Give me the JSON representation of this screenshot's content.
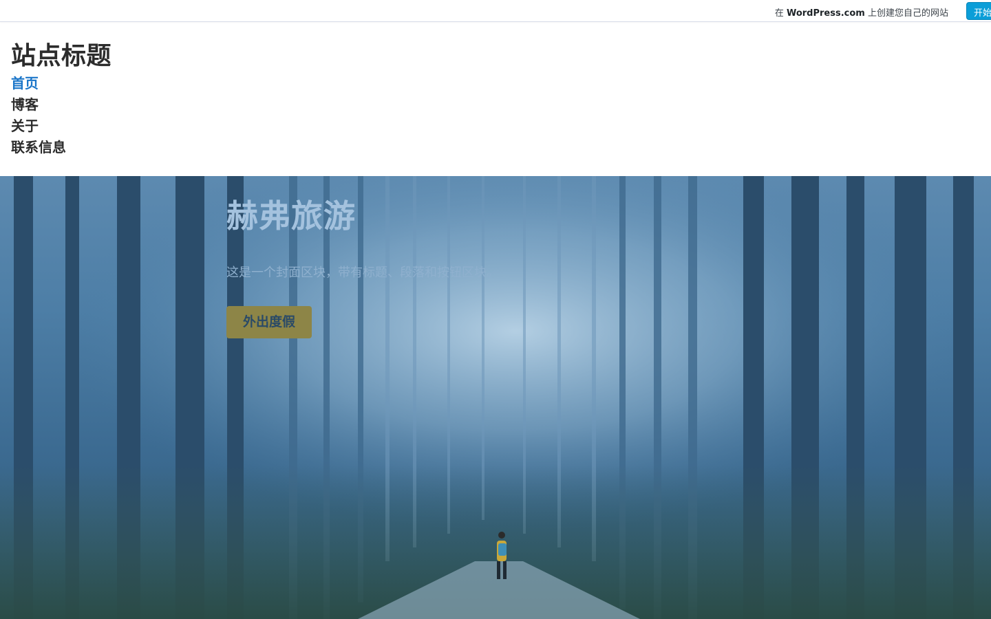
{
  "wp_banner": {
    "promo_prefix": "在 ",
    "promo_brand": "WordPress.com",
    "promo_suffix": " 上创建您自己的网站",
    "start_button": "开始"
  },
  "header": {
    "site_title": "站点标题",
    "nav": [
      {
        "label": "首页",
        "active": true
      },
      {
        "label": "博客",
        "active": false
      },
      {
        "label": "关于",
        "active": false
      },
      {
        "label": "联系信息",
        "active": false
      }
    ]
  },
  "cover": {
    "title": "赫弗旅游",
    "subtitle": "这是一个封面区块，带有标题、段落和按钮区块。",
    "button": "外出度假"
  },
  "colors": {
    "link_active": "#1b76c9",
    "wp_button": "#0b9ed8",
    "cover_button": "#8d8547"
  }
}
